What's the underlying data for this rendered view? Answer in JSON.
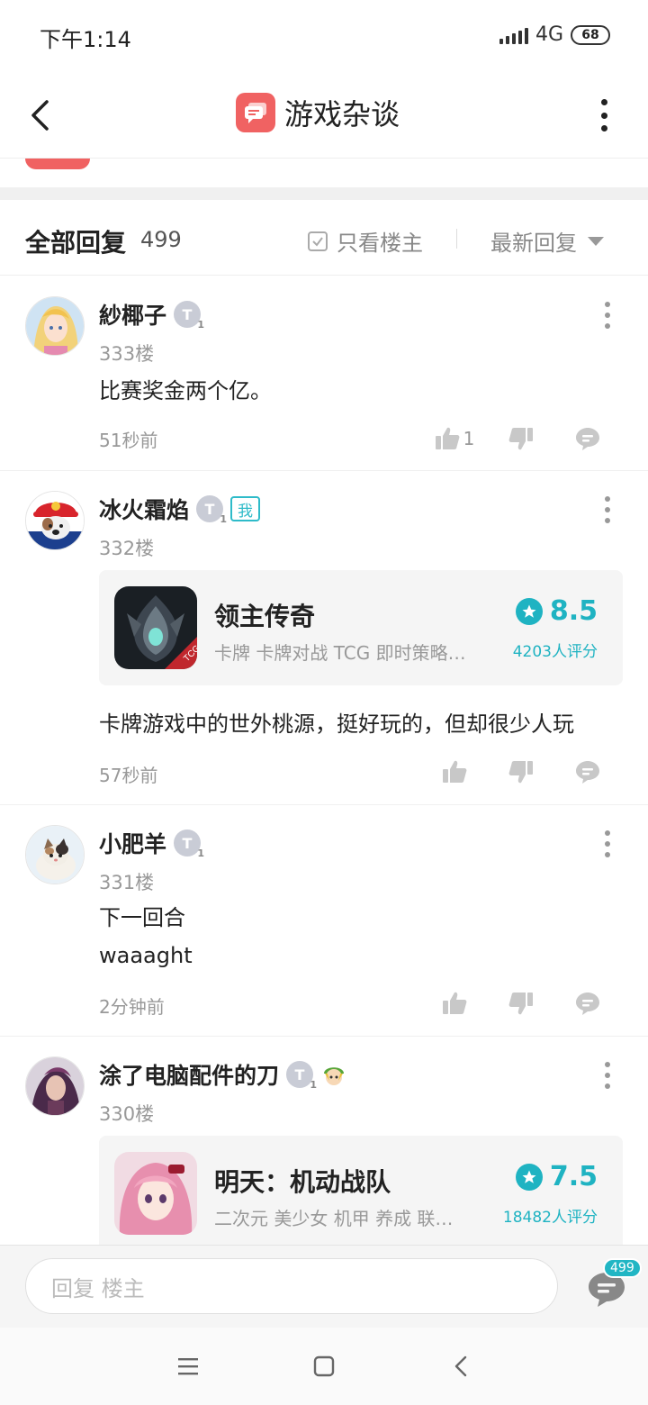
{
  "status_bar": {
    "time": "下午1:14",
    "network": "4G",
    "battery": "68"
  },
  "header": {
    "title": "游戏杂谈"
  },
  "reply_bar": {
    "title": "全部回复",
    "count": "499",
    "owner_only_label": "只看楼主",
    "sort_label": "最新回复"
  },
  "comments": [
    {
      "username": "紗椰子",
      "level": "T",
      "floor": "333楼",
      "lines": [
        "比赛奖金两个亿。"
      ],
      "time": "51秒前",
      "likes": "1"
    },
    {
      "username": "冰火霜焰",
      "level": "T",
      "me_tag": "我",
      "floor": "332楼",
      "game": {
        "name": "领主传奇",
        "tags": "卡牌  卡牌对战  TCG  即时策略…",
        "score": "8.5",
        "rating_count": "4203人评分"
      },
      "lines": [
        "卡牌游戏中的世外桃源，挺好玩的，但却很少人玩"
      ],
      "time": "57秒前",
      "likes": ""
    },
    {
      "username": "小肥羊",
      "level": "T",
      "floor": "331楼",
      "lines": [
        "下一回合",
        "waaaght"
      ],
      "time": "2分钟前",
      "likes": ""
    },
    {
      "username": "涂了电脑配件的刀",
      "level": "T",
      "floor": "330楼",
      "game": {
        "name": "明天：机动战队",
        "tags": "二次元  美少女  机甲  养成  联…",
        "score": "7.5",
        "rating_count": "18482人评分"
      }
    }
  ],
  "input_bar": {
    "placeholder": "回复  楼主",
    "comment_count": "499"
  },
  "colors": {
    "accent": "#1fb3c2",
    "brand_red": "#f06262",
    "muted": "#999999"
  },
  "icons": {
    "back": "chevron-left-icon",
    "more": "more-vertical-icon",
    "like": "thumbs-up-icon",
    "dislike": "thumbs-down-icon",
    "comment": "comment-icon",
    "star": "star-icon"
  }
}
